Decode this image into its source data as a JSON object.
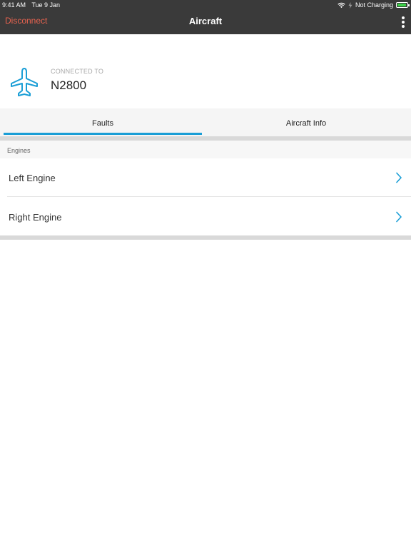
{
  "status_bar": {
    "time": "9:41 AM",
    "date": "Tue 9 Jan",
    "charging": "Not Charging",
    "icons": [
      "wifi-icon",
      "charging-icon",
      "battery-icon"
    ],
    "battery_color": "#3ecf4a"
  },
  "nav": {
    "disconnect_label": "Disconnect",
    "title": "Aircraft",
    "menu_icon": "more-vertical-icon",
    "disconnect_color": "#e8634f",
    "bar_color": "#3a3a3a"
  },
  "connection": {
    "icon": "airplane-icon",
    "label": "CONNECTED TO",
    "tail_number": "N2800",
    "accent_color": "#1a9ed6"
  },
  "tabs": {
    "items": [
      {
        "label": "Faults",
        "selected": true
      },
      {
        "label": "Aircraft Info",
        "selected": false
      }
    ]
  },
  "faults": {
    "section_title": "Engines",
    "items": [
      {
        "label": "Left Engine",
        "icon": "chevron-right-icon"
      },
      {
        "label": "Right Engine",
        "icon": "chevron-right-icon"
      }
    ]
  }
}
